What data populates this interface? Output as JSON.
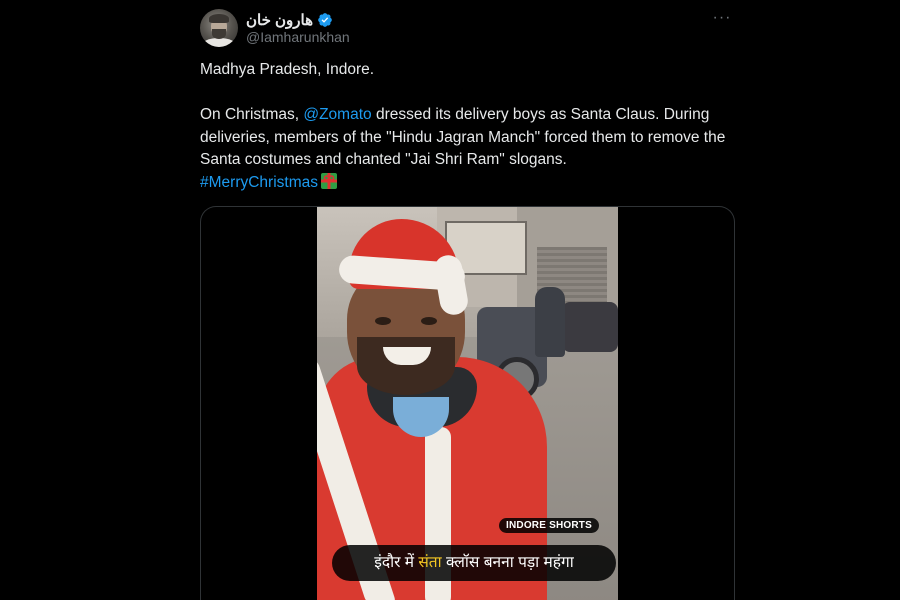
{
  "author": {
    "display_name": "هارون خان",
    "handle": "@Iamharunkhan",
    "verified": true,
    "avatar_icon": "user-avatar",
    "verified_color": "#1d9bf0"
  },
  "tweet": {
    "line1": "Madhya Pradesh, Indore.",
    "line2_before": "On Christmas, ",
    "mention": "@Zomato",
    "line2_after": " dressed its delivery boys as Santa Claus. During deliveries, members of the \"Hindu Jagran Manch\" forced them to remove the Santa costumes and chanted \"Jai Shri Ram\" slogans.",
    "hashtag": "#MerryChristmas",
    "emoji_icon": "wrapped-gift-icon"
  },
  "media": {
    "type": "video",
    "watermark": "INDORE SHORTS",
    "caption_before": "इंदौर में ",
    "caption_highlight": "संता",
    "caption_after": " क्लॉस बनना पड़ा महंगा"
  },
  "menu": {
    "more_icon": "more-horizontal-icon",
    "more_label": "···"
  },
  "colors": {
    "background": "#000000",
    "text": "#e7e9ea",
    "secondary_text": "#71767b",
    "link": "#1d9bf0",
    "caption_highlight": "#f3c623"
  }
}
